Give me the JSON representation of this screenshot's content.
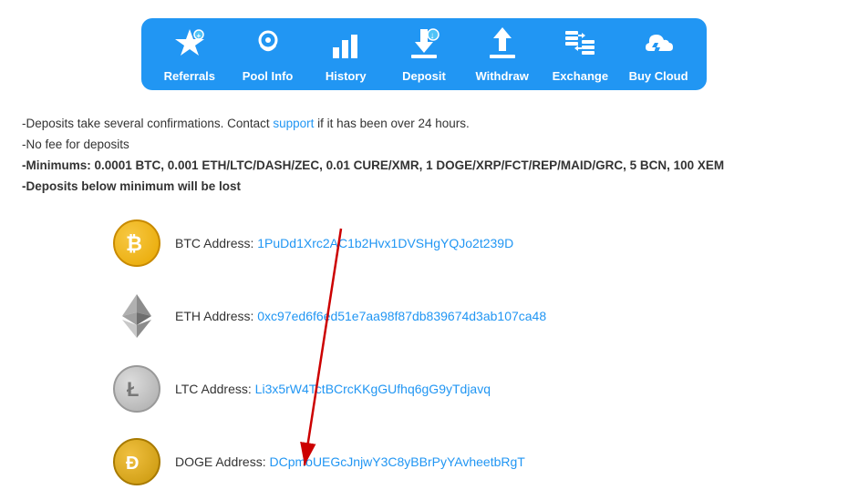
{
  "nav": {
    "items": [
      {
        "id": "referrals",
        "label": "Referrals",
        "icon": "⭐"
      },
      {
        "id": "pool-info",
        "label": "Pool Info",
        "icon": "☁"
      },
      {
        "id": "history",
        "label": "History",
        "icon": "📊"
      },
      {
        "id": "deposit",
        "label": "Deposit",
        "icon": "⬇"
      },
      {
        "id": "withdraw",
        "label": "Withdraw",
        "icon": "↑"
      },
      {
        "id": "exchange",
        "label": "Exchange",
        "icon": "⇄"
      },
      {
        "id": "buy-cloud",
        "label": "Buy Cloud",
        "icon": "🛒"
      }
    ]
  },
  "info": {
    "line1": "-Deposits take several confirmations. Contact support if it has been over 24 hours.",
    "line2": "-No fee for deposits",
    "line3": "-Minimums: 0.0001 BTC, 0.001 ETH/LTC/DASH/ZEC, 0.01 CURE/XMR, 1 DOGE/XRP/FCT/REP/MAID/GRC, 5 BCN, 100 XEM",
    "line4": "-Deposits below minimum will be lost",
    "support_label": "support"
  },
  "addresses": [
    {
      "id": "btc",
      "coin": "BTC",
      "label": "BTC Address:",
      "address": "1PuDd1Xrc2AC1b2Hvx1DVSHgYQJo2t239D",
      "icon_type": "btc",
      "icon_text": "₿"
    },
    {
      "id": "eth",
      "coin": "ETH",
      "label": "ETH Address:",
      "address": "0xc97ed6f6ed51e7aa98f87db839674d3ab107ca48",
      "icon_type": "eth",
      "icon_text": "◆"
    },
    {
      "id": "ltc",
      "coin": "LTC",
      "label": "LTC Address:",
      "address": "Li3x5rW4TctBCrcKKgGUfhq6gG9yTdjavq",
      "icon_type": "ltc",
      "icon_text": "Ł"
    },
    {
      "id": "doge",
      "coin": "DOGE",
      "label": "DOGE Address:",
      "address": "DCpmoUEGcJnjwY3C8yBBrPyYAvheetbRgT",
      "icon_type": "doge",
      "icon_text": "Ð"
    }
  ],
  "accent_color": "#2196f3"
}
